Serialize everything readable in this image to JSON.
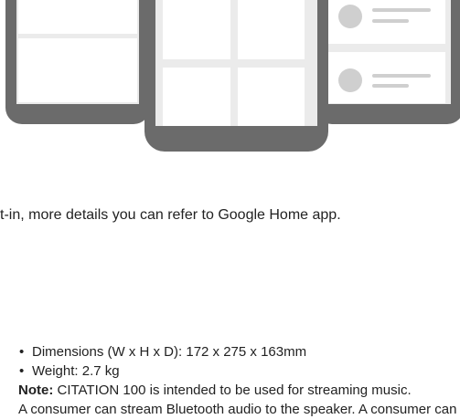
{
  "body_line": "t-in, more details you can refer to Google Home app.",
  "specs": {
    "items": [
      "Dimensions (W x H x D): 172 x 275 x 163mm",
      "Weight: 2.7 kg"
    ],
    "note_label": "Note:",
    "note_text": " CITATION 100 is intended to be used for streaming music.",
    "continuation": "A consumer can stream Bluetooth audio to the speaker. A consumer can"
  }
}
